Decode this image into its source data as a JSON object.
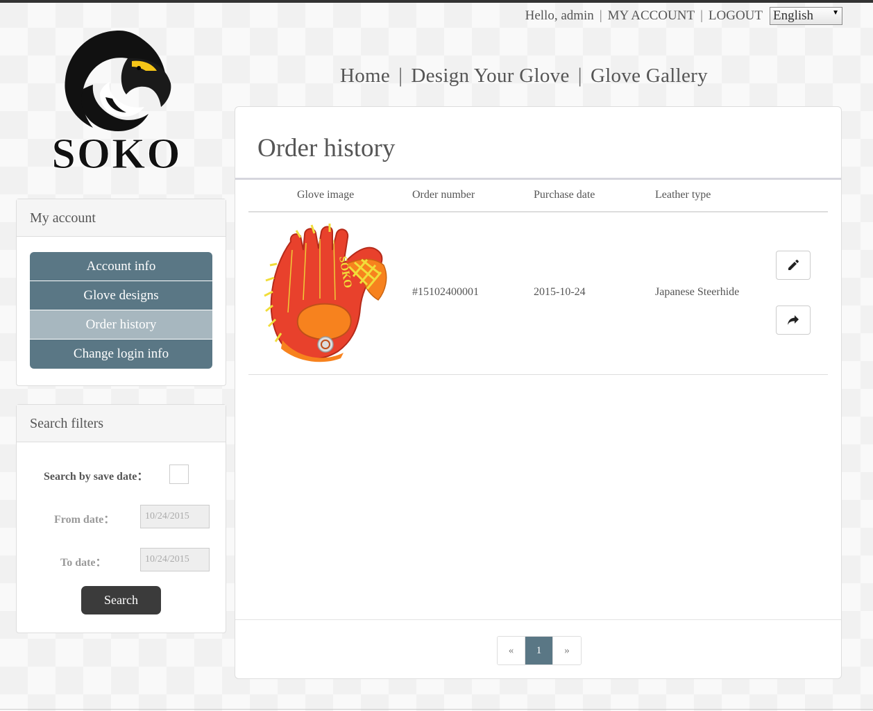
{
  "header": {
    "greeting": "Hello, admin",
    "my_account": "MY ACCOUNT",
    "logout": "LOGOUT",
    "separator": "|",
    "language": "English"
  },
  "logo": {
    "text": "SOKO"
  },
  "main_nav": {
    "items": [
      "Home",
      "Design Your Glove",
      "Glove Gallery"
    ],
    "separator": "|"
  },
  "sidebar": {
    "title": "My account",
    "items": [
      {
        "label": "Account info",
        "active": false
      },
      {
        "label": "Glove designs",
        "active": false
      },
      {
        "label": "Order history",
        "active": true
      },
      {
        "label": "Change login info",
        "active": false
      }
    ]
  },
  "filters": {
    "title": "Search filters",
    "save_date_label": "Search by save date：",
    "from_label": "From date：",
    "from_value": "10/24/2015",
    "to_label": "To date：",
    "to_value": "10/24/2015",
    "search_button": "Search"
  },
  "content": {
    "title": "Order history",
    "columns": [
      "Glove image",
      "Order number",
      "Purchase date",
      "Leather type"
    ],
    "orders": [
      {
        "order_number": "#15102400001",
        "purchase_date": "2015-10-24",
        "leather_type": "Japanese Steerhide",
        "glove_text": "SOKO",
        "actions": [
          "pencil-icon",
          "share-icon"
        ]
      }
    ]
  },
  "pagination": {
    "prev": "«",
    "pages": [
      "1"
    ],
    "current": "1",
    "next": "»"
  },
  "colors": {
    "menu": "#5a7785",
    "menu_active": "#a7b7bf",
    "glove_red": "#e8412c",
    "glove_orange": "#f7821e",
    "lace_yellow": "#f1dd3a",
    "search_button": "#3b3b3b"
  }
}
